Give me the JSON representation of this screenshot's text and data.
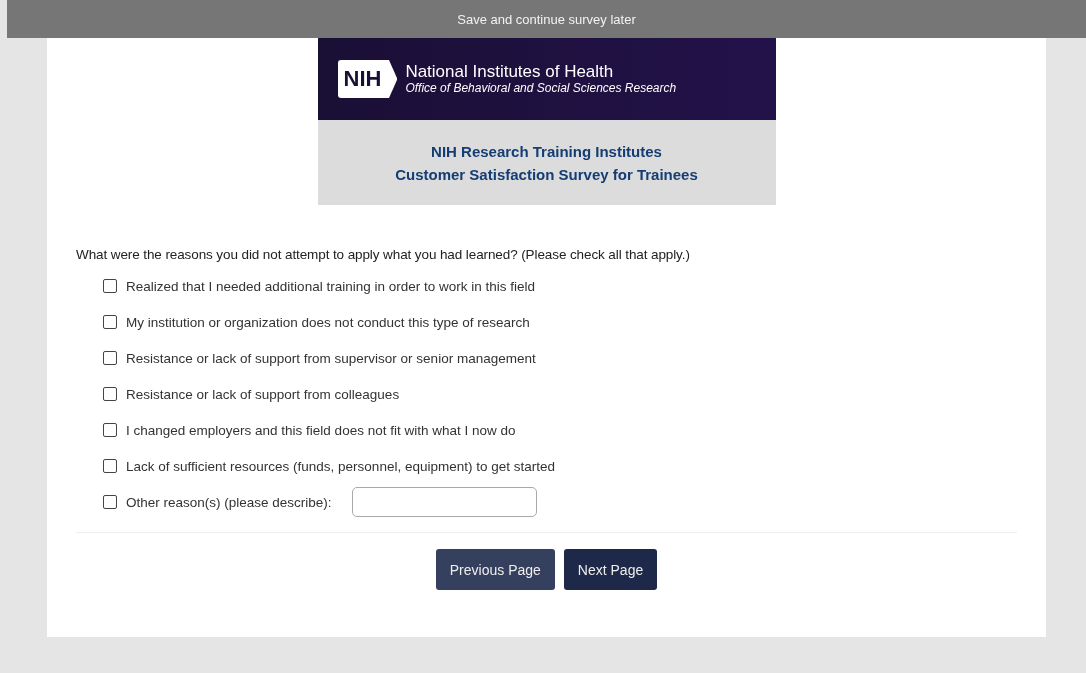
{
  "save_bar": {
    "label": "Save and continue survey later"
  },
  "banner": {
    "logo_text": "NIH",
    "org_name": "National Institutes of Health",
    "office": "Office of Behavioral and Social Sciences Research",
    "title_lines": [
      "NIH Research Training Institutes",
      "Customer Satisfaction Survey for Trainees"
    ]
  },
  "question": {
    "text": "What were the reasons you did not attempt to apply what you had learned? (Please check all that apply.)",
    "options": [
      {
        "label": "Realized that I needed additional training in order to work in this field",
        "checked": false
      },
      {
        "label": "My institution or organization does not conduct this type of research",
        "checked": false
      },
      {
        "label": "Resistance or lack of support from supervisor or senior management",
        "checked": false
      },
      {
        "label": "Resistance or lack of support from colleagues",
        "checked": false
      },
      {
        "label": "I changed employers and this field does not fit with what I now do",
        "checked": false
      },
      {
        "label": "Lack of sufficient resources (funds, personnel, equipment) to get started",
        "checked": false
      },
      {
        "label": "Other reason(s) (please describe):",
        "checked": false,
        "kind": "other"
      }
    ]
  },
  "buttons": [
    {
      "label": "Previous Page",
      "kind": "previous"
    },
    {
      "label": "Next Page",
      "kind": "next"
    }
  ]
}
